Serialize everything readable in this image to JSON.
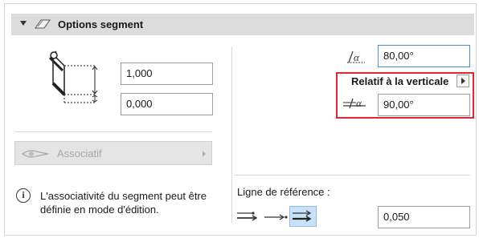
{
  "panel": {
    "title": "Options segment",
    "header_icon": "segment-icon",
    "collapse_icon": "triangle-down-icon"
  },
  "left": {
    "diagram_icon": "segment-height-diagram-icon",
    "height_value": "1,000",
    "offset_value": "0,000",
    "associative_label": "Associatif",
    "associative_icon": "associative-eye-icon",
    "info_text": "L'associativité du segment peut être définie en mode d'édition."
  },
  "right": {
    "angle_icon": "slope-angle-icon",
    "angle_value": "80,00°",
    "relative_label": "Relatif à la verticale",
    "relative_angle_icon": "vertical-angle-icon",
    "relative_angle_value": "90,00°",
    "ref_line_label": "Ligne de référence :",
    "ref_icons": [
      "ref-line-start-icon",
      "ref-line-middle-icon",
      "ref-line-end-icon"
    ],
    "ref_selected_index": 2,
    "ref_value": "0,050"
  },
  "colors": {
    "highlight_border": "#e1262c",
    "focus_border": "#4a90d9",
    "selected_bg": "#c9e1f8"
  }
}
